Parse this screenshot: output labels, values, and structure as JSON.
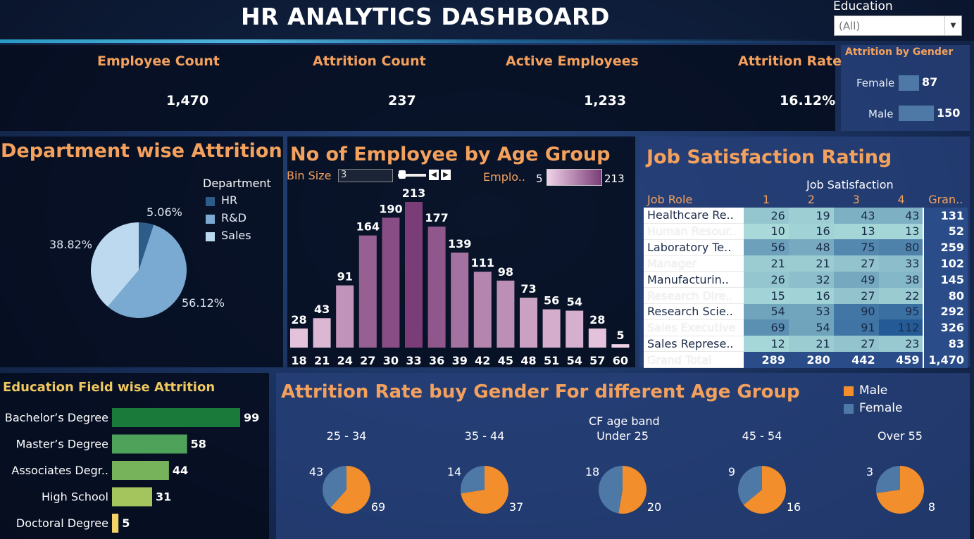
{
  "header": {
    "title": "HR ANALYTICS DASHBOARD",
    "filter_label": "Education",
    "filter_value": "(All)"
  },
  "kpis": [
    {
      "label": "Employee Count",
      "value": "1,470"
    },
    {
      "label": "Attrition Count",
      "value": "237"
    },
    {
      "label": "Active Employees",
      "value": "1,233"
    },
    {
      "label": "Attrition Rate",
      "value": "16.12%"
    }
  ],
  "gender_attrition": {
    "title": "Attrition by Gender",
    "items": [
      {
        "label": "Female",
        "value": "87",
        "num": 87
      },
      {
        "label": "Male",
        "value": "150",
        "num": 150
      }
    ]
  },
  "department": {
    "title": "Department wise Attrition",
    "legend_title": "Department",
    "legend": [
      {
        "label": "HR",
        "color": "#2e5c8a"
      },
      {
        "label": "R&D",
        "color": "#7aa9d1"
      },
      {
        "label": "Sales",
        "color": "#bcd9ef"
      }
    ],
    "labels": [
      "5.06%",
      "56.12%",
      "38.82%"
    ]
  },
  "age_group": {
    "title": "No of Employee by Age Group",
    "bin_label": "Bin Size",
    "bin_value": "3",
    "legend_label": "Emplo..",
    "legend_min": "5",
    "legend_max": "213"
  },
  "job_satisfaction": {
    "title": "Job Satisfaction Rating",
    "header_group": "Job Satisfaction",
    "col_role": "Job Role",
    "cols": [
      "1",
      "2",
      "3",
      "4",
      "Gran.."
    ],
    "rows": [
      {
        "role": "Healthcare Re..",
        "v": [
          "26",
          "19",
          "43",
          "43"
        ],
        "total": "131"
      },
      {
        "role": "Human Resour..",
        "v": [
          "10",
          "16",
          "13",
          "13"
        ],
        "total": "52"
      },
      {
        "role": "Laboratory Te..",
        "v": [
          "56",
          "48",
          "75",
          "80"
        ],
        "total": "259"
      },
      {
        "role": "Manager",
        "v": [
          "21",
          "21",
          "27",
          "33"
        ],
        "total": "102"
      },
      {
        "role": "Manufacturin..",
        "v": [
          "26",
          "32",
          "49",
          "38"
        ],
        "total": "145"
      },
      {
        "role": "Research Dire..",
        "v": [
          "15",
          "16",
          "27",
          "22"
        ],
        "total": "80"
      },
      {
        "role": "Research Scie..",
        "v": [
          "54",
          "53",
          "90",
          "95"
        ],
        "total": "292"
      },
      {
        "role": "Sales Executive",
        "v": [
          "69",
          "54",
          "91",
          "112"
        ],
        "total": "326"
      },
      {
        "role": "Sales Represe..",
        "v": [
          "12",
          "21",
          "27",
          "23"
        ],
        "total": "83"
      }
    ],
    "grand": {
      "role": "Grand Total",
      "v": [
        "289",
        "280",
        "442",
        "459"
      ],
      "total": "1,470"
    }
  },
  "education_field": {
    "title": "Education Field wise Attrition",
    "items": [
      {
        "label": "Bachelor’s Degree",
        "value": 99,
        "color": "#1a7a3a"
      },
      {
        "label": "Master’s Degree",
        "value": 58,
        "color": "#4fa25a"
      },
      {
        "label": "Associates Degr..",
        "value": 44,
        "color": "#77b35a"
      },
      {
        "label": "High School",
        "value": 31,
        "color": "#a4c45e"
      },
      {
        "label": "Doctoral Degree",
        "value": 5,
        "color": "#f3d26a"
      }
    ]
  },
  "gender_age": {
    "title": "Attrition Rate buy Gender For different Age Group",
    "legend": [
      {
        "label": "Male",
        "color": "#f28e2b"
      },
      {
        "label": "Female",
        "color": "#4e79a7"
      }
    ],
    "band_title": "CF age band",
    "bands": [
      {
        "label": "25 - 34",
        "female": 43,
        "male": 69
      },
      {
        "label": "35 - 44",
        "female": 14,
        "male": 37
      },
      {
        "label": "Under 25",
        "female": 18,
        "male": 20
      },
      {
        "label": "45 - 54",
        "female": 9,
        "male": 16
      },
      {
        "label": "Over 55",
        "female": 3,
        "male": 8
      }
    ]
  },
  "chart_data": [
    {
      "type": "bar",
      "title": "No of Employee by Age Group",
      "categories": [
        "18",
        "21",
        "24",
        "27",
        "30",
        "33",
        "36",
        "39",
        "42",
        "45",
        "48",
        "51",
        "54",
        "57",
        "60"
      ],
      "values": [
        28,
        43,
        91,
        164,
        190,
        213,
        177,
        139,
        111,
        98,
        73,
        56,
        54,
        28,
        5
      ]
    },
    {
      "type": "pie",
      "title": "Department wise Attrition",
      "categories": [
        "HR",
        "R&D",
        "Sales"
      ],
      "values": [
        5.06,
        56.12,
        38.82
      ]
    },
    {
      "type": "bar",
      "title": "Education Field wise Attrition",
      "categories": [
        "Bachelor’s Degree",
        "Master’s Degree",
        "Associates Degr..",
        "High School",
        "Doctoral Degree"
      ],
      "values": [
        99,
        58,
        44,
        31,
        5
      ]
    }
  ]
}
